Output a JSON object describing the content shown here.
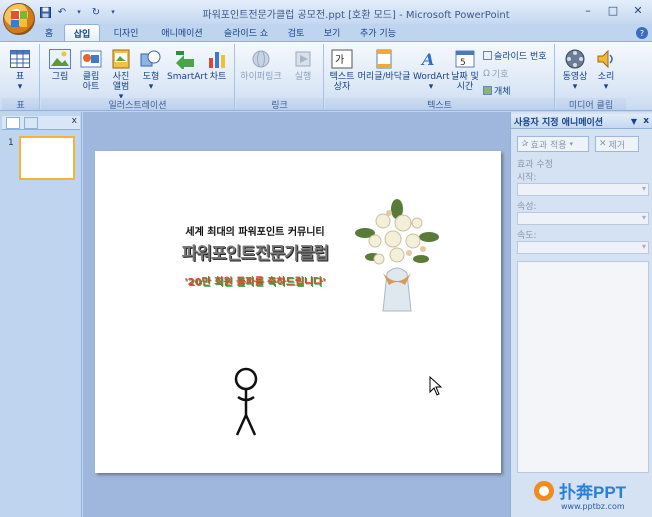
{
  "window": {
    "title": "파워포인트전문가클럽 공모전.ppt [호환 모드] - Microsoft PowerPoint",
    "controls": [
      "–",
      "□",
      "✕"
    ]
  },
  "tabs": [
    "홈",
    "삽입",
    "디자인",
    "애니메이션",
    "슬라이드 쇼",
    "검토",
    "보기",
    "추가 기능"
  ],
  "active_tab": "삽입",
  "ribbon": {
    "groups": {
      "table": "표",
      "illustrations": "일러스트레이션",
      "links": "링크",
      "text": "텍스트",
      "media": "미디어 클립"
    },
    "buttons": {
      "table": "표",
      "picture": "그림",
      "clipart_1": "클립",
      "clipart_2": "아트",
      "album_1": "사진",
      "album_2": "앨범",
      "shapes": "도형",
      "smartart": "SmartArt",
      "chart": "차트",
      "hyperlink": "하이퍼링크",
      "action": "실행",
      "textbox_1": "텍스트",
      "textbox_2": "상자",
      "header_footer": "머리글/바닥글",
      "wordart": "WordArt",
      "datetime_1": "날짜 및",
      "datetime_2": "시간",
      "slide_number": "슬라이드 번호",
      "symbol": "기호",
      "object": "개체",
      "movie": "동영상",
      "sound": "소리"
    }
  },
  "left_pane": {
    "slide_number": "1"
  },
  "slide": {
    "line1": "세계 최대의 파워포인트 커뮤니티",
    "line2": "파워포인트전문가클럽",
    "line3": "'20만 회원 돌파를 축하드립니다'"
  },
  "task_pane": {
    "title": "사용자 지정 애니메이션",
    "add_effect": "효과 적용",
    "remove": "제거",
    "modify_label": "효과 수정",
    "start_label": "시작:",
    "property_label": "속성:",
    "speed_label": "속도:"
  },
  "watermark": {
    "text": "扑奔PPT",
    "url": "www.pptbz.com",
    "color": "#2a7fd6"
  }
}
